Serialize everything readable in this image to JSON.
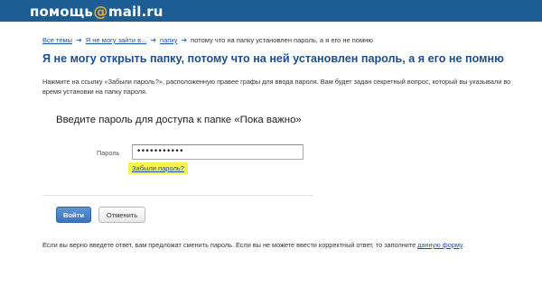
{
  "header": {
    "logo_main": "помощь",
    "logo_at": "@",
    "logo_domain": "mail",
    "logo_dot_ru": ".ru"
  },
  "breadcrumb": {
    "items": [
      "Все темы",
      "Я не могу зайти в...",
      "папку",
      "потому что на папку установлен пароль, а я его не помню"
    ],
    "separator": "➜"
  },
  "page": {
    "title": "Я не могу открыть папку, потому что на ней установлен пароль, а я его не помню",
    "intro": "Нажмите на ссылку «Забыли пароль?», расположенную правее графы для ввода пароля. Вам будет задан секретный вопрос, который вы указывали во время установки на папку пароля."
  },
  "dialog": {
    "title": "Введите пароль для доступа к папке «Пока важно»",
    "password_label": "Пароль",
    "password_value": "•••••••••••",
    "forgot_link": "Забыли пароль?",
    "login_button": "Войти",
    "cancel_button": "Отменить"
  },
  "footer": {
    "text_before_link": "Если вы верно введете ответ, вам предложат сменить пароль. Если вы не можете ввести корректный ответ, то заполните ",
    "link": "данную форму",
    "text_after_link": "."
  },
  "colors": {
    "header_bg": "#1c5d94",
    "logo_at": "#f0a82a",
    "link": "#1a53a0",
    "title": "#1c4e8f",
    "highlight": "#f8f250",
    "primary_button": "#3a73c0"
  }
}
